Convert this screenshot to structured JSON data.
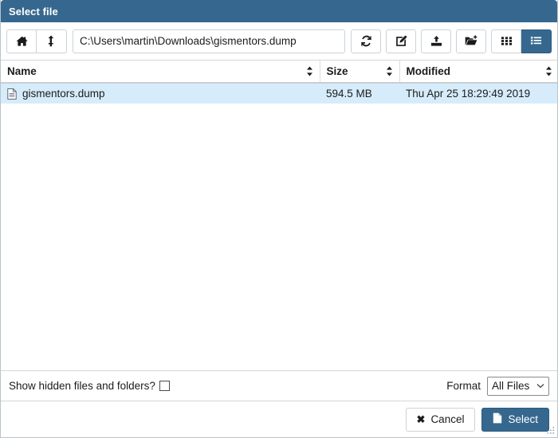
{
  "dialog": {
    "title": "Select file"
  },
  "toolbar": {
    "home_icon": "home-icon",
    "up_icon": "level-up-icon",
    "path_value": "C:\\Users\\martin\\Downloads\\gismentors.dump",
    "path_placeholder": "Path",
    "refresh_icon": "refresh-icon",
    "rename_icon": "edit-rename-icon",
    "upload_icon": "upload-icon",
    "new_folder_icon": "new-folder-icon",
    "grid_view_icon": "grid-view-icon",
    "list_view_icon": "list-view-icon"
  },
  "filelist": {
    "columns": [
      {
        "label": "Name",
        "sort_icon": "sort-icon"
      },
      {
        "label": "Size",
        "sort_icon": "sort-icon"
      },
      {
        "label": "Modified",
        "sort_icon": "sort-icon"
      }
    ],
    "rows": [
      {
        "icon": "file-icon",
        "name": "gismentors.dump",
        "size": "594.5 MB",
        "modified": "Thu Apr 25 18:29:49 2019",
        "selected": true
      }
    ]
  },
  "options": {
    "hidden_label": "Show hidden files and folders?",
    "hidden_checked": false,
    "format_label": "Format",
    "format_value": "All Files",
    "format_options": [
      "All Files"
    ]
  },
  "footer": {
    "cancel_label": "Cancel",
    "cancel_icon": "close-x-icon",
    "select_label": "Select",
    "select_icon": "file-icon"
  },
  "colors": {
    "titlebar_blue": "#36688f",
    "accent_blue": "#36688f",
    "row_selected": "#d6ecfa",
    "border_gray": "#ccd2d6"
  }
}
